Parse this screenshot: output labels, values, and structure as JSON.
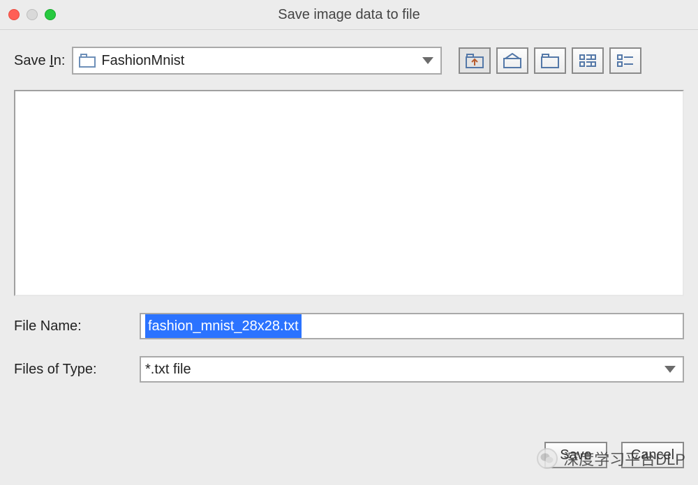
{
  "titlebar": {
    "title": "Save image data to file"
  },
  "saveIn": {
    "label_prefix": "Save ",
    "label_ul": "I",
    "label_suffix": "n:",
    "folder": "FashionMnist"
  },
  "fileName": {
    "label_prefix": "File ",
    "label_ul": "N",
    "label_suffix": "ame:",
    "value": "fashion_mnist_28x28.txt"
  },
  "fileType": {
    "label_prefix": "Files of ",
    "label_ul": "T",
    "label_suffix": "ype:",
    "value": "*.txt file"
  },
  "actions": {
    "save": "Save",
    "cancel": "Cancel"
  },
  "watermark": {
    "text": "深度学习平台DLP"
  }
}
